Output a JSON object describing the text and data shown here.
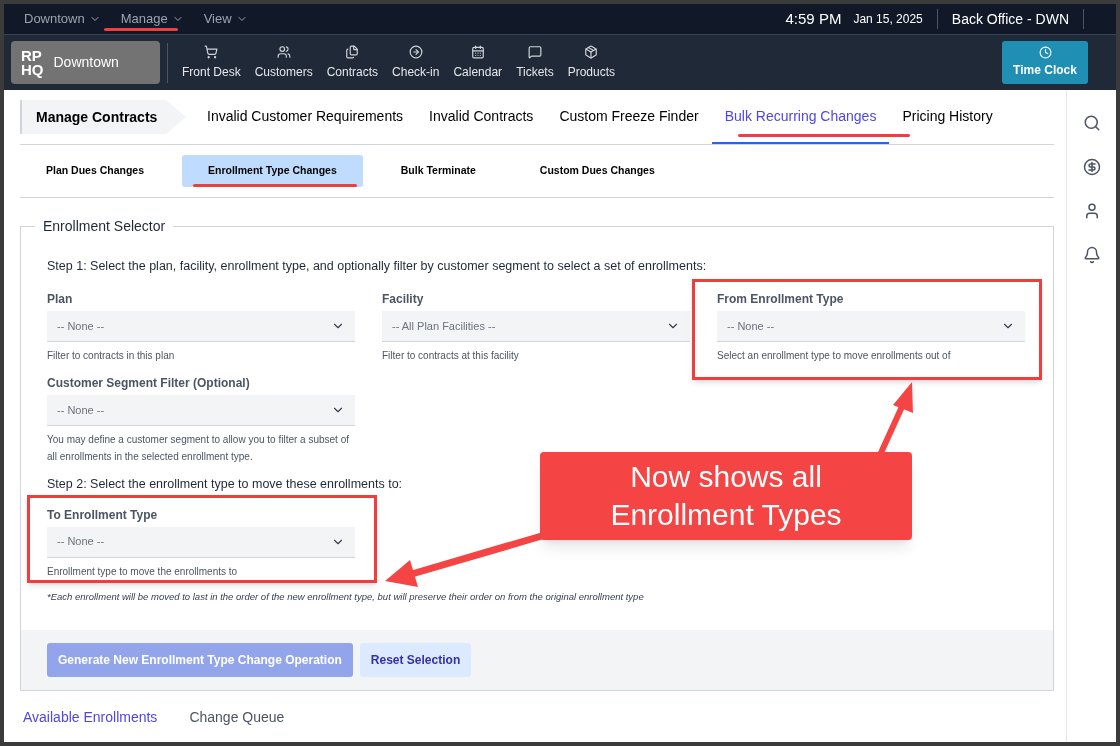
{
  "top_menu": [
    {
      "label": "Downtown"
    },
    {
      "label": "Manage"
    },
    {
      "label": "View"
    }
  ],
  "top_right": {
    "time": "4:59 PM",
    "date": "Jan 15, 2025",
    "location": "Back Office - DWN"
  },
  "logo": {
    "mark_lines": [
      "RP",
      "HQ"
    ],
    "name": "Downtown"
  },
  "nav": [
    {
      "label": "Front Desk",
      "kind": "cart"
    },
    {
      "label": "Customers",
      "kind": "users"
    },
    {
      "label": "Contracts",
      "kind": "files"
    },
    {
      "label": "Check-in",
      "kind": "arrow"
    },
    {
      "label": "Calendar",
      "kind": "calendar"
    },
    {
      "label": "Tickets",
      "kind": "chat"
    },
    {
      "label": "Products",
      "kind": "box"
    }
  ],
  "time_clock": "Time Clock",
  "breadcrumb": "Manage Contracts",
  "tabs": [
    {
      "label": "Invalid Customer Requirements",
      "selected": false
    },
    {
      "label": "Invalid Contracts",
      "selected": false
    },
    {
      "label": "Custom Freeze Finder",
      "selected": false
    },
    {
      "label": "Bulk Recurring Changes",
      "selected": true
    },
    {
      "label": "Pricing History",
      "selected": false
    }
  ],
  "subtabs": [
    {
      "label": "Plan Dues Changes",
      "selected": false
    },
    {
      "label": "Enrollment Type Changes",
      "selected": true
    },
    {
      "label": "Bulk Terminate",
      "selected": false
    },
    {
      "label": "Custom Dues Changes",
      "selected": false
    }
  ],
  "selector": {
    "legend": "Enrollment Selector",
    "step1": "Step 1: Select the plan, facility, enrollment type, and optionally filter by customer segment to select a set of enrollments:",
    "fields": [
      {
        "label": "Plan",
        "value": "-- None --",
        "help": "Filter to contracts in this plan"
      },
      {
        "label": "Facility",
        "value": "-- All Plan Facilities --",
        "help": "Filter to contracts at this facility"
      },
      {
        "label": "From Enrollment Type",
        "value": "-- None --",
        "help": "Select an enrollment type to move enrollments out of"
      },
      {
        "label": "Customer Segment Filter (Optional)",
        "value": "-- None --",
        "help": "You may define a customer segment to allow you to filter a subset of all enrollments in the selected enrollment type."
      }
    ],
    "step2": "Step 2: Select the enrollment type to move these enrollments to:",
    "to_field": {
      "label": "To Enrollment Type",
      "value": "-- None --",
      "help": "Enrollment type to move the enrollments to"
    },
    "note": "*Each enrollment will be moved to last in the order of the new enrollment type, but will preserve their order on from the original enrollment type"
  },
  "footer": {
    "buttons": [
      {
        "label": "Generate New Enrollment Type Change Operation",
        "kind": "primary",
        "disabled": true
      },
      {
        "label": "Reset Selection",
        "kind": "secondary",
        "disabled": false
      }
    ]
  },
  "bottom_tabs": [
    {
      "label": "Available Enrollments",
      "selected": true
    },
    {
      "label": "Change Queue",
      "selected": false
    }
  ],
  "annotation": {
    "callout": "Now shows all Enrollment Types"
  }
}
